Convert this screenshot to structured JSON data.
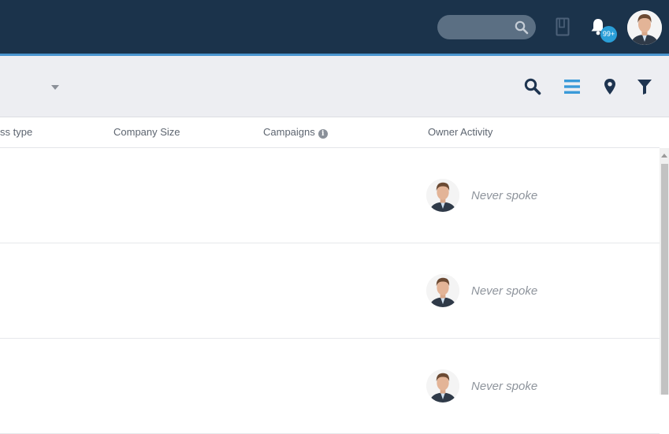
{
  "header": {
    "search": {
      "placeholder": "",
      "icon": "search-icon"
    },
    "notifications": {
      "badge": "99+",
      "icon": "bell-icon"
    },
    "colors": {
      "background": "#1b334b",
      "accent": "#4a95cf",
      "badge": "#2a9fd8"
    }
  },
  "toolbar": {
    "icons": [
      "search-icon",
      "list-view-icon",
      "map-pin-icon",
      "filter-icon"
    ],
    "active_view": "list-view-icon",
    "active_color": "#3a9ad9"
  },
  "table": {
    "columns": [
      "ss type",
      "Company Size",
      "Campaigns",
      "Owner Activity"
    ],
    "rows": [
      {
        "business_type": "",
        "company_size": "",
        "campaigns": "",
        "owner_activity": "Never spoke"
      },
      {
        "business_type": "",
        "company_size": "",
        "campaigns": "",
        "owner_activity": "Never spoke"
      },
      {
        "business_type": "",
        "company_size": "",
        "campaigns": "",
        "owner_activity": "Never spoke"
      }
    ]
  }
}
